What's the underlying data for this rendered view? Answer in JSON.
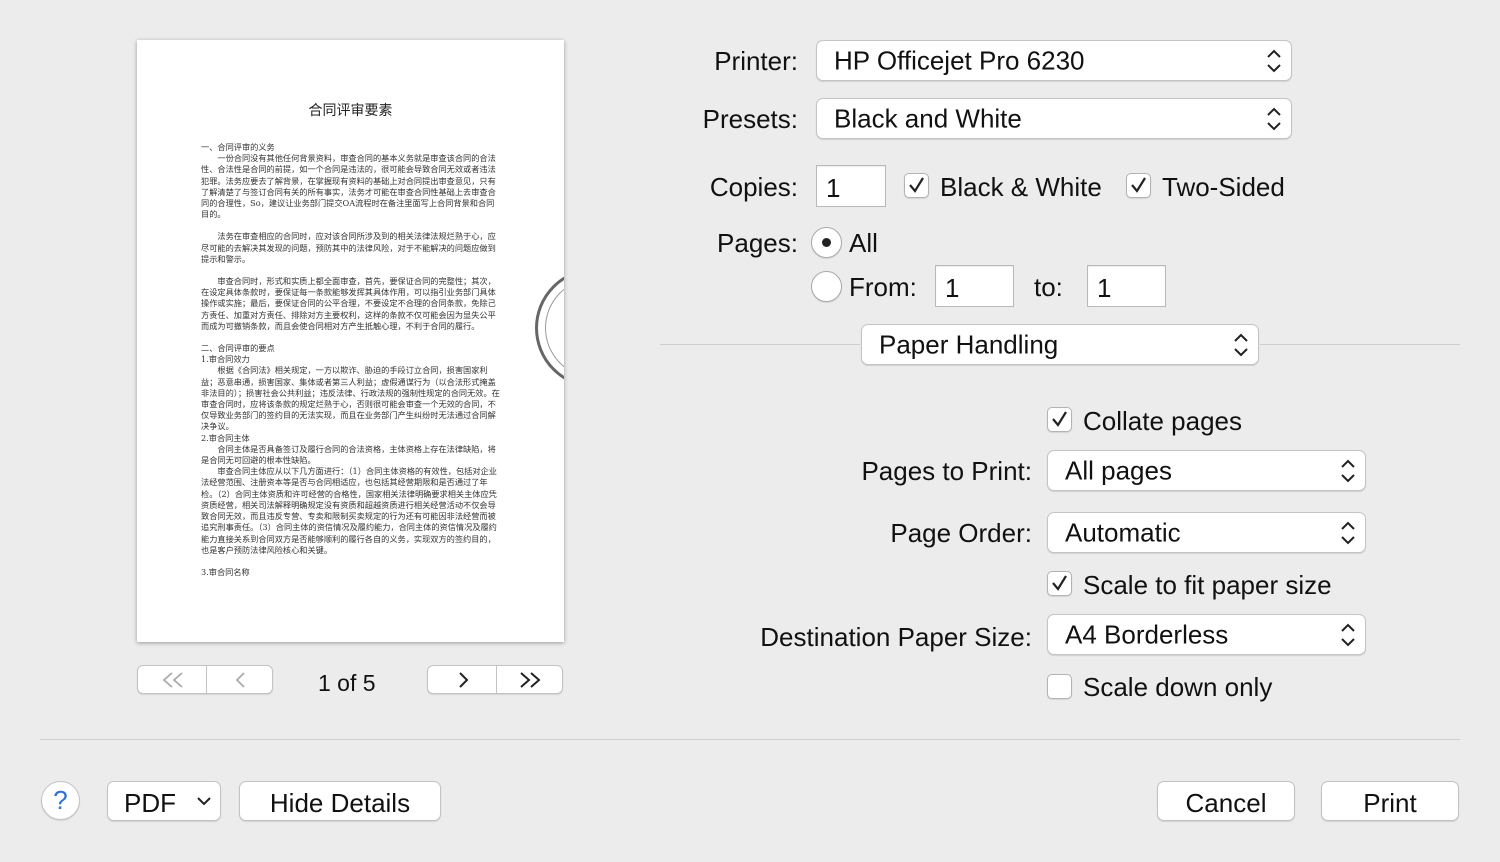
{
  "preview": {
    "doc_title": "合同评审要素",
    "paragraphs": [
      "一、合同评审的义务",
      "一份合同没有其他任何背景资料，审查合同的基本义务就是审查该合同的合法性、合法性是合同的前提，如一个合同是违法的，很可能会导致合同无效或者违法犯罪。法务应要去了解背景，在掌握现有资料的基础上对合同提出审查意见，只有了解清楚了与签订合同有关的所有事实，法务才可能在审查合同性基础上去审查合同的合理性，So，建议让业务部门提交OA流程时在备注里面写上合同背景和合同目的。",
      "",
      "法务在审查相应的合同时，应对该合同所涉及到的相关法律法规烂熟于心，应尽可能的去解决其发现的问题，预防其中的法律风险，对于不能解决的问题应做到提示和警示。",
      "",
      "审查合同时，形式和实质上都全面审查，首先，要保证合同的完整性；其次，在设定具体条款时，要保证每一条款能够发挥其具体作用，可以指引业务部门具体操作或实施；最后，要保证合同的公平合理，不要设定不合理的合同条款，免除己方责任、加重对方责任、排除对方主要权利，这样的条款不仅可能会因为显失公平而成为可撤销条款，而且会使合同相对方产生抵触心理，不利于合同的履行。",
      "",
      "二、合同评审的要点",
      "1.审合同效力",
      "根据《合同法》相关规定，一方以欺诈、胁迫的手段订立合同，损害国家利益；恶意串通，损害国家、集体或者第三人利益；虚假通谋行为（以合法形式掩盖非法目的）；损害社会公共利益；违反法律、行政法规的强制性规定的合同无效。在审查合同时，应将该条款的规定烂熟于心，否则很可能会审查一个无效的合同，不仅导致业务部门的签约目的无法实现，而且在业务部门产生纠纷时无法通过合同解决争议。",
      "2.审合同主体",
      "合同主体是否具备签订及履行合同的合法资格，主体资格上存在法律缺陷，将是合同无可回避的根本性缺陷。",
      "审查合同主体应从以下几方面进行：（1）合同主体资格的有效性，包括对企业法经营范围、注册资本等是否与合同相适应，也包括其经营期限和是否通过了年检。（2）合同主体资质和许可经营的合格性，国家相关法律明确要求相关主体应凭资质经营，相关司法解释明确规定没有资质和超越资质进行相关经营活动不仅会导致合同无效，而且违反专营、专卖和限制买卖规定的行为还有可能因非法经营而被追究刑事责任。（3）合同主体的资信情况及履约能力，合同主体的资信情况及履约能力直接关系到合同双方是否能够顺利的履行各自的义务，实现双方的签约目的，也是客户预防法律风险核心和关键。",
      "",
      "3.审合同名称"
    ],
    "page_indicator": "1 of 5"
  },
  "printer": {
    "label": "Printer:",
    "value": "HP Officejet Pro 6230"
  },
  "presets": {
    "label": "Presets:",
    "value": "Black and White"
  },
  "copies": {
    "label": "Copies:",
    "value": "1",
    "black_white": {
      "label": "Black & White",
      "checked": true
    },
    "two_sided": {
      "label": "Two-Sided",
      "checked": true
    }
  },
  "pages": {
    "label": "Pages:",
    "all_label": "All",
    "from_label": "From:",
    "from_value": "1",
    "to_label": "to:",
    "to_value": "1",
    "selected": "all"
  },
  "section": {
    "value": "Paper Handling"
  },
  "paper_handling": {
    "collate": {
      "label": "Collate pages",
      "checked": true
    },
    "pages_to_print": {
      "label": "Pages to Print:",
      "value": "All pages"
    },
    "page_order": {
      "label": "Page Order:",
      "value": "Automatic"
    },
    "scale_to_fit": {
      "label": "Scale to fit paper size",
      "checked": true
    },
    "destination": {
      "label": "Destination Paper Size:",
      "value": "A4 Borderless"
    },
    "scale_down": {
      "label": "Scale down only",
      "checked": false
    }
  },
  "footer": {
    "help": "?",
    "pdf": "PDF",
    "hide_details": "Hide Details",
    "cancel": "Cancel",
    "print": "Print"
  },
  "icons": {
    "updown": "updown-chevrons-icon",
    "check": "checkmark-icon",
    "first": "double-chevron-left-icon",
    "prev": "chevron-left-icon",
    "next": "chevron-right-icon",
    "last": "double-chevron-right-icon",
    "dropdown": "chevron-down-icon"
  },
  "colors": {
    "background": "#ececec",
    "help_accent": "#2a6fe0"
  }
}
